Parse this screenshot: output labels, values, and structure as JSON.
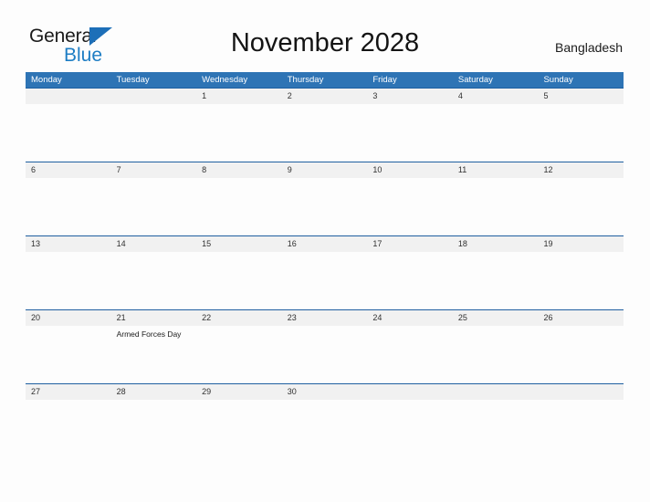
{
  "brand": {
    "name_top": "General",
    "name_bottom": "Blue",
    "triangle_color": "#1d6fb8",
    "blue_text_color": "#1d7dc4"
  },
  "header": {
    "title": "November 2028",
    "country": "Bangladesh"
  },
  "theme": {
    "header_blue": "#2e74b5",
    "band_gray": "#f1f1f1",
    "rule_blue": "#1f5fa0",
    "page_bg": "#fdfdfd"
  },
  "calendar": {
    "weekdays": [
      "Monday",
      "Tuesday",
      "Wednesday",
      "Thursday",
      "Friday",
      "Saturday",
      "Sunday"
    ],
    "weeks": [
      {
        "days": [
          {
            "number": "",
            "event": ""
          },
          {
            "number": "",
            "event": ""
          },
          {
            "number": "1",
            "event": ""
          },
          {
            "number": "2",
            "event": ""
          },
          {
            "number": "3",
            "event": ""
          },
          {
            "number": "4",
            "event": ""
          },
          {
            "number": "5",
            "event": ""
          }
        ]
      },
      {
        "days": [
          {
            "number": "6",
            "event": ""
          },
          {
            "number": "7",
            "event": ""
          },
          {
            "number": "8",
            "event": ""
          },
          {
            "number": "9",
            "event": ""
          },
          {
            "number": "10",
            "event": ""
          },
          {
            "number": "11",
            "event": ""
          },
          {
            "number": "12",
            "event": ""
          }
        ]
      },
      {
        "days": [
          {
            "number": "13",
            "event": ""
          },
          {
            "number": "14",
            "event": ""
          },
          {
            "number": "15",
            "event": ""
          },
          {
            "number": "16",
            "event": ""
          },
          {
            "number": "17",
            "event": ""
          },
          {
            "number": "18",
            "event": ""
          },
          {
            "number": "19",
            "event": ""
          }
        ]
      },
      {
        "days": [
          {
            "number": "20",
            "event": ""
          },
          {
            "number": "21",
            "event": "Armed Forces Day"
          },
          {
            "number": "22",
            "event": ""
          },
          {
            "number": "23",
            "event": ""
          },
          {
            "number": "24",
            "event": ""
          },
          {
            "number": "25",
            "event": ""
          },
          {
            "number": "26",
            "event": ""
          }
        ]
      },
      {
        "days": [
          {
            "number": "27",
            "event": ""
          },
          {
            "number": "28",
            "event": ""
          },
          {
            "number": "29",
            "event": ""
          },
          {
            "number": "30",
            "event": ""
          },
          {
            "number": "",
            "event": ""
          },
          {
            "number": "",
            "event": ""
          },
          {
            "number": "",
            "event": ""
          }
        ]
      }
    ]
  }
}
